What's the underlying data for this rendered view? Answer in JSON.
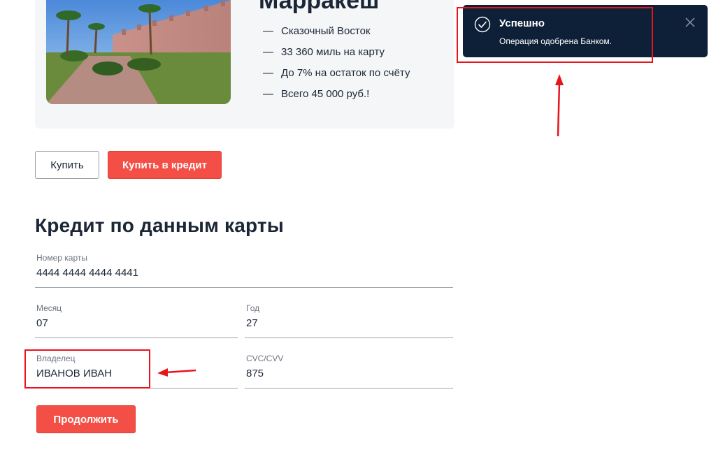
{
  "offer": {
    "title": "Марракеш",
    "photo_icon": "marrakesh-photo",
    "features": [
      {
        "dash": "—",
        "text": "Сказочный Восток"
      },
      {
        "dash": "—",
        "text": "33 360 миль на карту"
      },
      {
        "dash": "—",
        "text": "До 7% на остаток по счёту"
      },
      {
        "dash": "—",
        "text": "Всего 45 000 руб.!"
      }
    ]
  },
  "buttons": {
    "buy_label": "Купить",
    "buy_credit_label": "Купить в кредит",
    "continue_label": "Продолжить"
  },
  "form": {
    "title": "Кредит по данным карты",
    "card_number": {
      "label": "Номер карты",
      "value": "4444 4444 4444 4441"
    },
    "month": {
      "label": "Месяц",
      "value": "07"
    },
    "year": {
      "label": "Год",
      "value": "27"
    },
    "owner": {
      "label": "Владелец",
      "value": "ИВАНОВ ИВАН"
    },
    "cvc": {
      "label": "CVC/CVV",
      "value": "875"
    }
  },
  "toast": {
    "title": "Успешно",
    "message": "Операция одобрена Банком.",
    "status_icon": "check-circle-icon",
    "close_icon": "close-icon"
  },
  "colors": {
    "accent": "#f34f46",
    "toast_bg": "#0e2037",
    "annotation": "#e8141c",
    "text": "#1b2636"
  }
}
